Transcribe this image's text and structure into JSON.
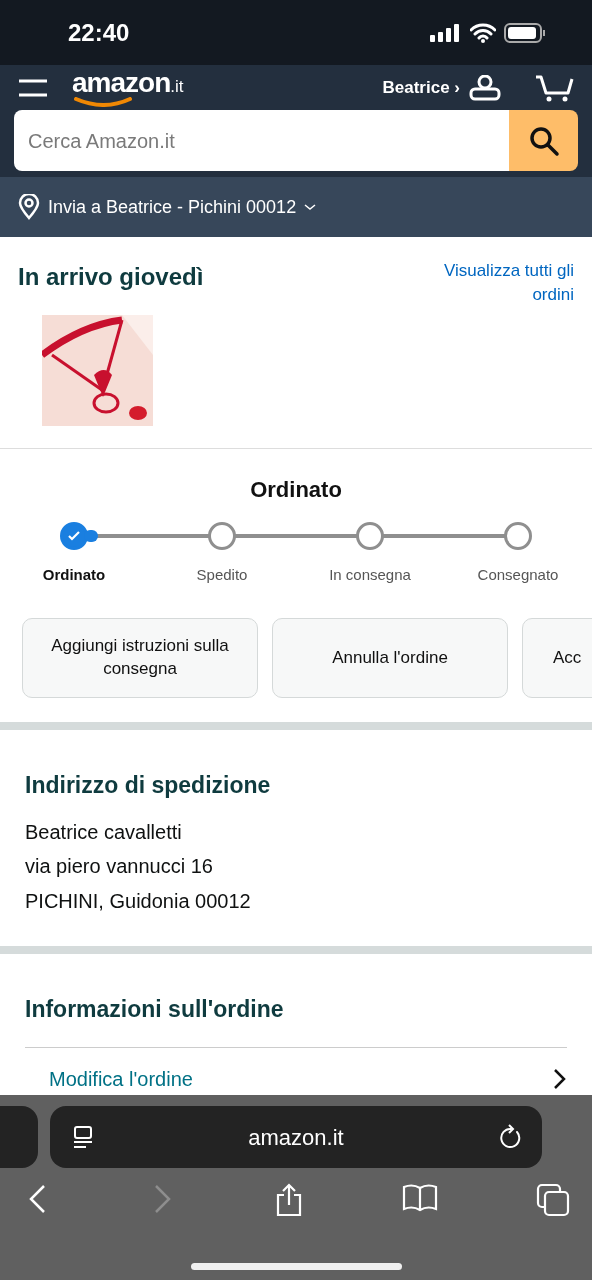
{
  "status_bar": {
    "time": "22:40"
  },
  "header": {
    "logo": "amazon",
    "logo_suffix": ".it",
    "account": "Beatrice ›"
  },
  "search": {
    "placeholder": "Cerca Amazon.it"
  },
  "delivery": {
    "label": "Invia a Beatrice - Pichini 00012"
  },
  "arrival": {
    "title": "In arrivo giovedì",
    "link": "Visualizza tutti gli ordini"
  },
  "progress": {
    "title": "Ordinato",
    "steps": [
      {
        "label": "Ordinato",
        "completed": true
      },
      {
        "label": "Spedito",
        "completed": false
      },
      {
        "label": "In consegna",
        "completed": false
      },
      {
        "label": "Consegnato",
        "completed": false
      }
    ]
  },
  "actions": [
    {
      "label": "Aggiungi istruzioni sulla consegna"
    },
    {
      "label": "Annulla l'ordine"
    },
    {
      "label": "Acc"
    }
  ],
  "shipping_address": {
    "title": "Indirizzo di spedizione",
    "lines": [
      "Beatrice cavalletti",
      "via piero vannucci 16",
      "PICHINI, Guidonia 00012"
    ]
  },
  "order_info": {
    "title": "Informazioni sull'ordine",
    "items": [
      {
        "label": "Modifica l'ordine"
      }
    ]
  },
  "browser": {
    "url": "amazon.it"
  }
}
